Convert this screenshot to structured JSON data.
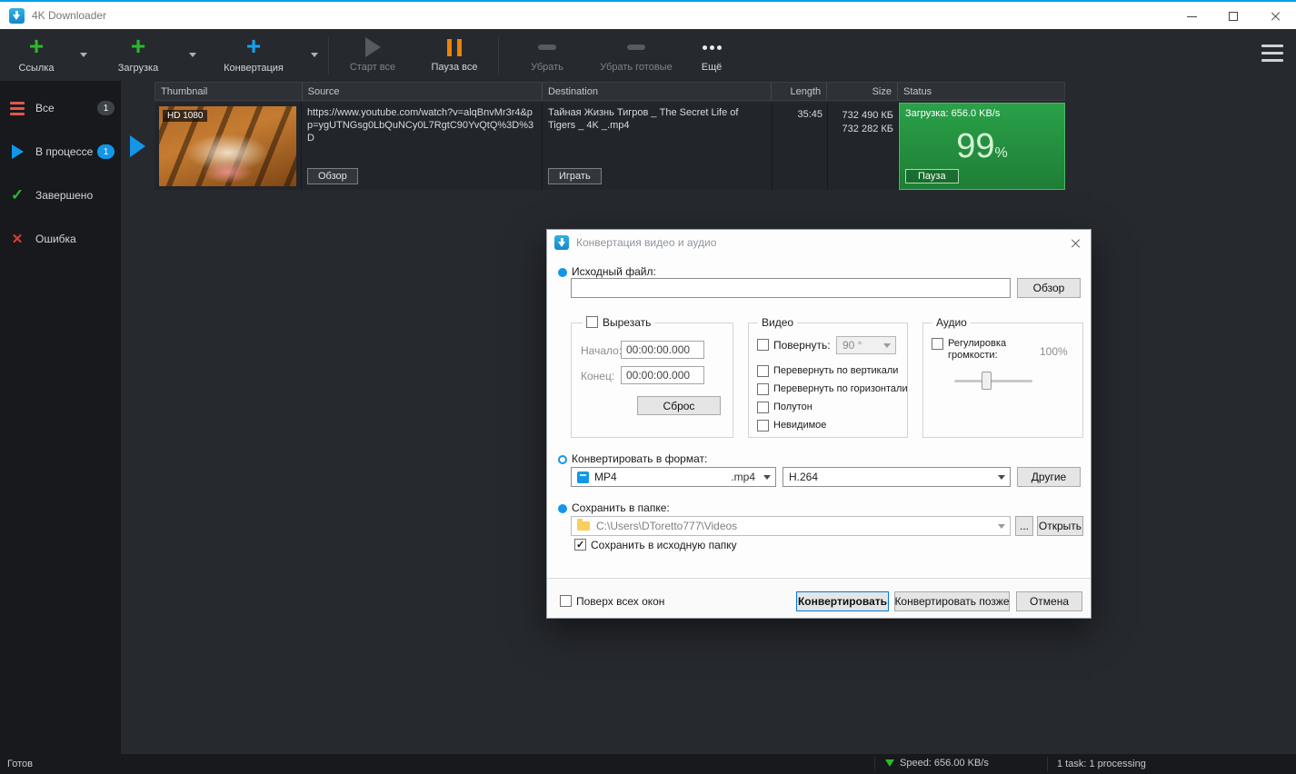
{
  "window": {
    "title": "4K Downloader",
    "statusbar": {
      "ready": "Готов",
      "speed": "Speed: 656.00 KB/s",
      "tasks": "1 task: 1 processing"
    }
  },
  "colors": {
    "accent_blue": "#1496e8",
    "plus_green": "#2db92d",
    "pause_orange": "#e8820c",
    "status_green": "#1e7e35"
  },
  "toolbar": {
    "link": "Ссылка",
    "download": "Загрузка",
    "convert": "Конвертация",
    "start_all": "Старт все",
    "pause_all": "Пауза все",
    "remove": "Убрать",
    "remove_done": "Убрать готовые",
    "more": "Ещё"
  },
  "sidebar": {
    "items": [
      {
        "label": "Все",
        "badge": "1"
      },
      {
        "label": "В процессе",
        "badge": "1"
      },
      {
        "label": "Завершено",
        "badge": ""
      },
      {
        "label": "Ошибка",
        "badge": ""
      }
    ]
  },
  "table": {
    "columns": [
      "Thumbnail",
      "Source",
      "Destination",
      "Length",
      "Size",
      "Status"
    ],
    "row": {
      "quality": "HD 1080",
      "source_url": "https://www.youtube.com/watch?v=alqBnvMr3r4&pp=ygUTNGsg0LbQuNCy0L7RgtC90YvQtQ%3D%3D",
      "browse_label": "Обзор",
      "destination": "Тайная Жизнь Тигров _ The Secret Life of Tigers _ 4K _.mp4",
      "play_label": "Играть",
      "length": "35:45",
      "size_total": "732 490 КБ",
      "size_done": "732 282 КБ",
      "status_text": "Загрузка: 656.0 KB/s",
      "progress_percent": "99",
      "percent_sign": "%",
      "pause_label": "Пауза"
    }
  },
  "dialog": {
    "title": "Конвертация видео и аудио",
    "source_label": "Исходный файл:",
    "source_value": "",
    "browse": "Обзор",
    "cut": {
      "checkbox": "Вырезать",
      "start_label": "Начало:",
      "start_value": "00:00:00.000",
      "end_label": "Конец:",
      "end_value": "00:00:00.000",
      "reset": "Сброс"
    },
    "video": {
      "title": "Видео",
      "rotate": "Повернуть:",
      "rotate_value": "90 °",
      "flip_v": "Перевернуть по вертикали",
      "flip_h": "Перевернуть по горизонтали",
      "halftone": "Полутон",
      "invisible": "Невидимое"
    },
    "audio": {
      "title": "Аудио",
      "volume": "Регулировка громкости:",
      "volume_value": "100%"
    },
    "format_label": "Конвертировать в формат:",
    "format_value": "MP4",
    "format_ext": ".mp4",
    "codec_value": "H.264",
    "others": "Другие",
    "folder_label": "Сохранить в папке:",
    "folder_path": "C:\\Users\\DToretto777\\Videos",
    "dots": "...",
    "open": "Открыть",
    "save_source": "Сохранить в исходную папку",
    "on_top": "Поверх всех окон",
    "convert_btn": "Конвертировать",
    "convert_later_btn": "Конвертировать позже",
    "cancel_btn": "Отмена"
  }
}
